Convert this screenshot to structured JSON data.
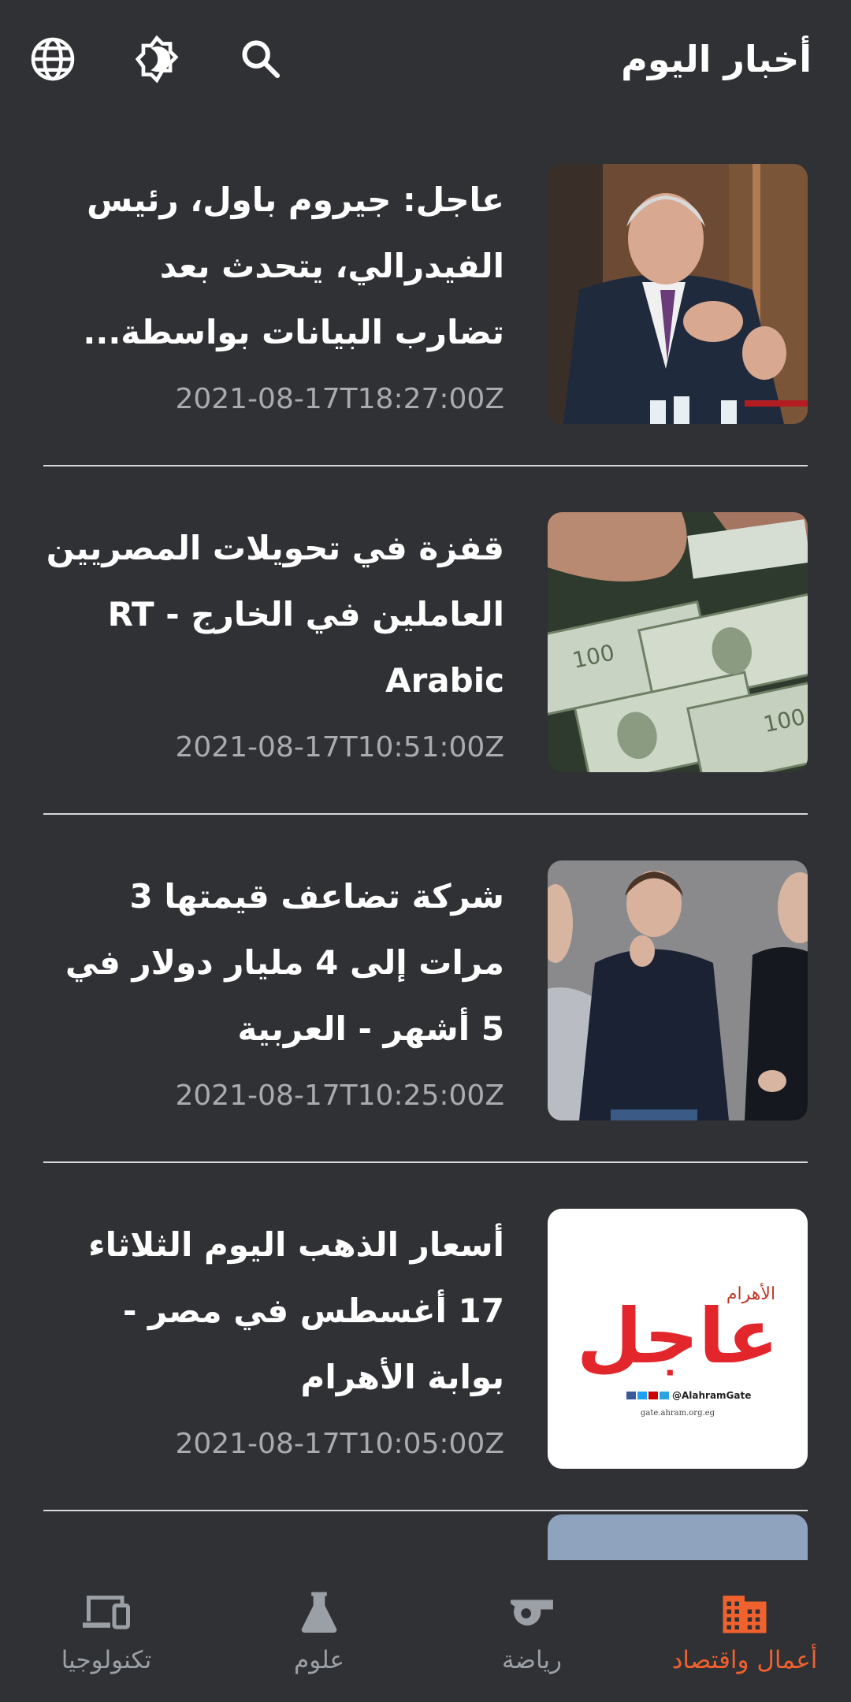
{
  "app": {
    "title": "أخبار اليوم"
  },
  "colors": {
    "background": "#303134",
    "accent": "#f1612e",
    "muted": "#9aa0a6",
    "divider": "#d8d8d8"
  },
  "header": {
    "actions": [
      {
        "icon": "search-icon"
      },
      {
        "icon": "brightness-icon"
      },
      {
        "icon": "language-globe-icon"
      }
    ]
  },
  "articles": [
    {
      "headline": "عاجل: جيروم باول، رئيس الفيدرالي، يتحدث بعد تضارب البيانات بواسطة...",
      "timestamp": "2021-08-17T18:27:00Z",
      "image": "speaker-photo"
    },
    {
      "headline": "قفزة في تحويلات المصريين العاملين في الخارج - RT Arabic",
      "timestamp": "2021-08-17T10:51:00Z",
      "image": "dollar-bills-photo"
    },
    {
      "headline": "شركة تضاعف قيمتها 3 مرات إلى 4 مليار دولار في 5 أشهر - العربية",
      "timestamp": "2021-08-17T10:25:00Z",
      "image": "founders-photo"
    },
    {
      "headline": "أسعار الذهب اليوم الثلاثاء 17 أغسطس في مصر - بوابة الأهرام",
      "timestamp": "2021-08-17T10:05:00Z",
      "image": "ahram-breaking-logo"
    }
  ],
  "ahram_logo": {
    "word": "عاجل",
    "brand": "الأهرام",
    "handle": "@AlahramGate",
    "url": "gate.ahram.org.eg"
  },
  "bottom_nav": {
    "items": [
      {
        "label": "أعمال واقتصاد",
        "icon": "building-icon",
        "active": true
      },
      {
        "label": "رياضة",
        "icon": "whistle-icon",
        "active": false
      },
      {
        "label": "علوم",
        "icon": "flask-icon",
        "active": false
      },
      {
        "label": "تكنولوجيا",
        "icon": "devices-icon",
        "active": false
      }
    ]
  }
}
